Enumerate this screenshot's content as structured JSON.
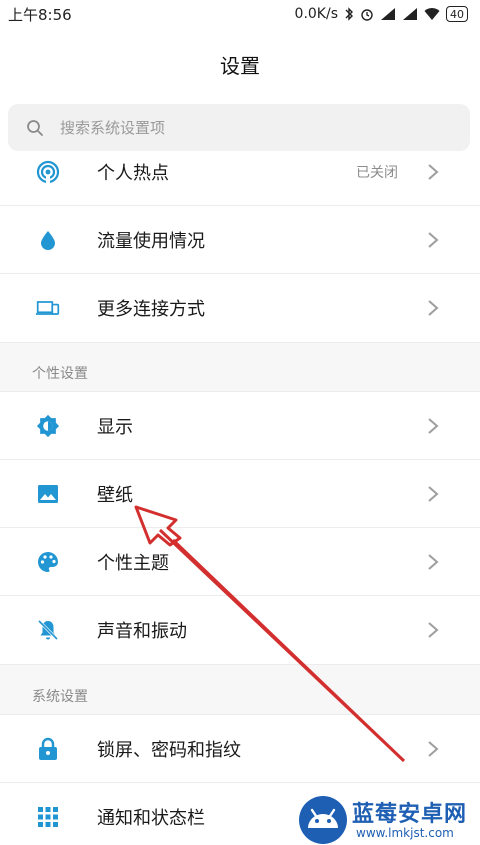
{
  "status_bar": {
    "time": "上午8:56",
    "network_speed": "0.0K/s",
    "battery": "40",
    "icons": [
      "bluetooth-icon",
      "alarm-icon",
      "signal-icon",
      "signal-icon",
      "wifi-icon",
      "battery-icon"
    ]
  },
  "header": {
    "title": "设置"
  },
  "search": {
    "placeholder": "搜索系统设置项"
  },
  "sections": {
    "connection": {
      "items": [
        {
          "label": "个人热点",
          "value": "已关闭",
          "icon": "hotspot-icon"
        },
        {
          "label": "流量使用情况",
          "icon": "data-usage-icon"
        },
        {
          "label": "更多连接方式",
          "icon": "devices-icon"
        }
      ]
    },
    "personal": {
      "title": "个性设置",
      "items": [
        {
          "label": "显示",
          "icon": "brightness-icon"
        },
        {
          "label": "壁纸",
          "icon": "wallpaper-icon"
        },
        {
          "label": "个性主题",
          "icon": "palette-icon"
        },
        {
          "label": "声音和振动",
          "icon": "bell-mute-icon"
        }
      ]
    },
    "system": {
      "title": "系统设置",
      "items": [
        {
          "label": "锁屏、密码和指纹",
          "icon": "lock-icon"
        },
        {
          "label": "通知和状态栏",
          "icon": "grid-icon"
        }
      ]
    }
  },
  "watermark": {
    "brand": "蓝莓安卓网",
    "url": "www.lmkjst.com"
  },
  "colors": {
    "accent": "#2196d3",
    "arrow": "#d32f2f",
    "background": "#ffffff"
  }
}
